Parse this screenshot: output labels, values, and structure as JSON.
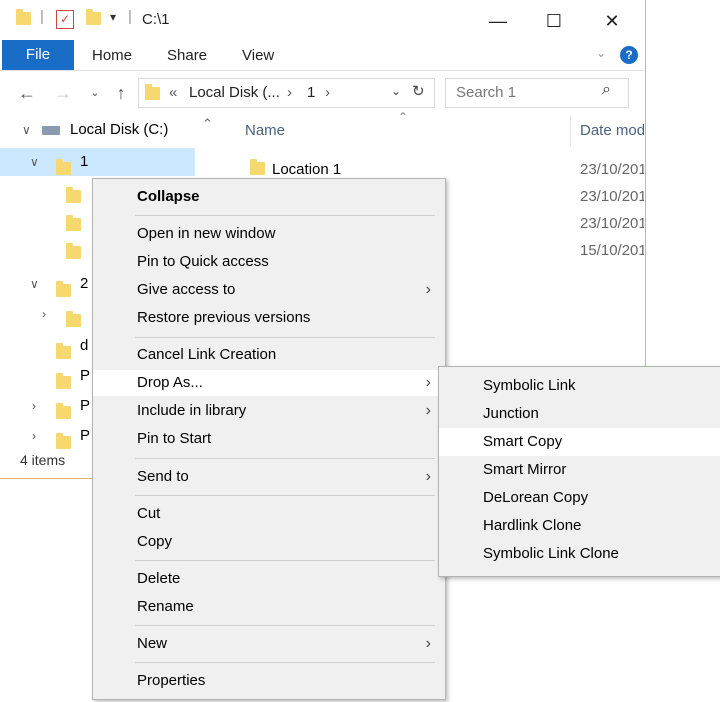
{
  "window": {
    "title": "C:\\1",
    "minimize": "—",
    "maximize": "☐",
    "close": "✕"
  },
  "ribbon": {
    "tabs": [
      "File",
      "Home",
      "Share",
      "View"
    ],
    "help": "?"
  },
  "address": {
    "prefix": "«",
    "seg1": "Local Disk (...",
    "sep": "›",
    "seg2": "1",
    "sep2": "›"
  },
  "search": {
    "placeholder": "Search 1"
  },
  "tree": {
    "root": "Local Disk (C:)",
    "item1": "1",
    "item2": "2",
    "partial_d": "d",
    "partial_p1": "P",
    "partial_p2": "P",
    "partial_p3": "P"
  },
  "list": {
    "col_name": "Name",
    "col_date": "Date mod",
    "first_item": "Location 1",
    "dates": [
      "23/10/201",
      "23/10/201",
      "23/10/201",
      "15/10/201"
    ]
  },
  "status": {
    "count": "4 items"
  },
  "context_menu": {
    "items": [
      {
        "label": "Collapse",
        "bold": true
      },
      {
        "label": "Open in new window"
      },
      {
        "label": "Pin to Quick access"
      },
      {
        "label": "Give access to",
        "submenu": true
      },
      {
        "label": "Restore previous versions"
      },
      {
        "label": "Cancel Link Creation"
      },
      {
        "label": "Drop As...",
        "submenu": true,
        "highlighted": true
      },
      {
        "label": "Include in library",
        "submenu": true
      },
      {
        "label": "Pin to Start"
      },
      {
        "label": "Send to",
        "submenu": true
      },
      {
        "label": "Cut"
      },
      {
        "label": "Copy"
      },
      {
        "label": "Delete"
      },
      {
        "label": "Rename"
      },
      {
        "label": "New",
        "submenu": true
      },
      {
        "label": "Properties"
      }
    ]
  },
  "submenu": {
    "items": [
      {
        "label": "Symbolic Link"
      },
      {
        "label": "Junction"
      },
      {
        "label": "Smart Copy",
        "highlighted": true
      },
      {
        "label": "Smart Mirror"
      },
      {
        "label": "DeLorean Copy"
      },
      {
        "label": "Hardlink Clone"
      },
      {
        "label": "Symbolic Link Clone"
      }
    ]
  }
}
